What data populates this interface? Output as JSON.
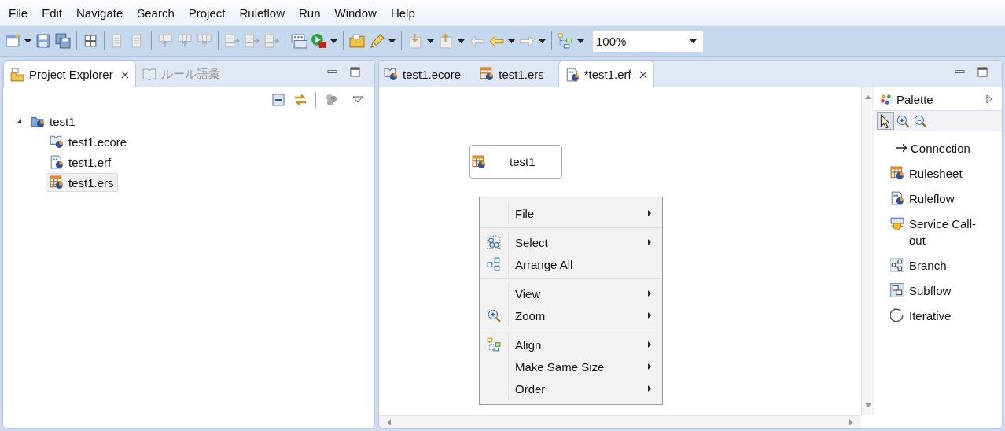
{
  "menu_bar": [
    "File",
    "Edit",
    "Navigate",
    "Search",
    "Project",
    "Ruleflow",
    "Run",
    "Window",
    "Help"
  ],
  "toolbar": {
    "zoom_combo": {
      "value": "100%"
    }
  },
  "explorer": {
    "tabs": [
      {
        "label": "Project Explorer",
        "selected": true,
        "kind": "explorer"
      },
      {
        "label": "ルール語彙",
        "selected": false,
        "kind": "vocabulary"
      }
    ],
    "tree": [
      {
        "label": "test1",
        "kind": "project",
        "expanded": true,
        "selected": false,
        "children": [
          {
            "label": "test1.ecore",
            "kind": "ecore",
            "selected": false
          },
          {
            "label": "test1.erf",
            "kind": "erf",
            "selected": false
          },
          {
            "label": "test1.ers",
            "kind": "ers",
            "selected": true
          }
        ]
      }
    ]
  },
  "editor": {
    "tabs": [
      {
        "label": "test1.ecore",
        "kind": "ecore",
        "selected": false
      },
      {
        "label": "test1.ers",
        "kind": "ers",
        "selected": false
      },
      {
        "label": "*test1.erf",
        "kind": "erf",
        "selected": true
      }
    ],
    "nodes": [
      {
        "label": "test1",
        "kind": "ers"
      }
    ],
    "context_menu": [
      [
        {
          "label": "File",
          "submenu": true
        }
      ],
      [
        {
          "label": "Select",
          "kind": "select",
          "submenu": true
        },
        {
          "label": "Arrange All",
          "kind": "arrange",
          "submenu": false
        }
      ],
      [
        {
          "label": "View",
          "submenu": true
        },
        {
          "label": "Zoom",
          "kind": "zoom",
          "submenu": true
        }
      ],
      [
        {
          "label": "Align",
          "kind": "align",
          "submenu": true
        },
        {
          "label": "Make Same Size",
          "submenu": true
        },
        {
          "label": "Order",
          "submenu": true
        }
      ]
    ]
  },
  "palette": {
    "title": "Palette",
    "tools": [
      {
        "kind": "select",
        "selected": true
      },
      {
        "kind": "zoom_in",
        "selected": false
      },
      {
        "kind": "zoom_out",
        "selected": false
      }
    ],
    "items": [
      {
        "label": "Connection",
        "kind": "connection"
      },
      {
        "label": "Rulesheet",
        "kind": "ers"
      },
      {
        "label": "Ruleflow",
        "kind": "erf"
      },
      {
        "label": "Service Call-out",
        "kind": "service"
      },
      {
        "label": "Branch",
        "kind": "branch"
      },
      {
        "label": "Subflow",
        "kind": "subflow"
      },
      {
        "label": "Iterative",
        "kind": "iterative"
      }
    ]
  }
}
